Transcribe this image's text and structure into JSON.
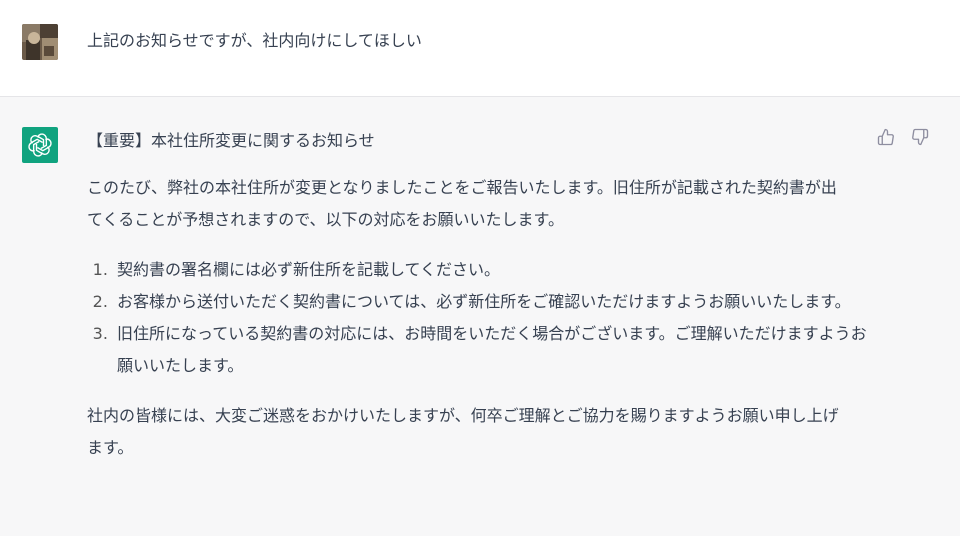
{
  "user_message": {
    "text": "上記のお知らせですが、社内向けにしてほしい"
  },
  "assistant_message": {
    "title": "【重要】本社住所変更に関するお知らせ",
    "intro_line1": "このたび、弊社の本社住所が変更となりましたことをご報告いたします。旧住所が記載された契約書が出",
    "intro_line2": "てくることが予想されますので、以下の対応をお願いいたします。",
    "list_items": [
      {
        "line1": "契約書の署名欄には必ず新住所を記載してください。"
      },
      {
        "line1": "お客様から送付いただく契約書については、必ず新住所をご確認いただけますようお願いいたします。"
      },
      {
        "line1": "旧住所になっている契約書の対応には、お時間をいただく場合がございます。ご理解いただけますようお",
        "line2": "願いいたします。"
      }
    ],
    "closing_line1": "社内の皆様には、大変ご迷惑をおかけいたしますが、何卒ご理解とご協力を賜りますようお願い申し上げ",
    "closing_line2": "ます。"
  },
  "icons": {
    "bot_avatar": "openai-logo-icon",
    "thumbs_up": "thumbs-up-icon",
    "thumbs_down": "thumbs-down-icon"
  },
  "colors": {
    "bot_avatar_bg": "#10a37f",
    "assistant_bg": "#f7f7f8",
    "text": "#374151"
  }
}
